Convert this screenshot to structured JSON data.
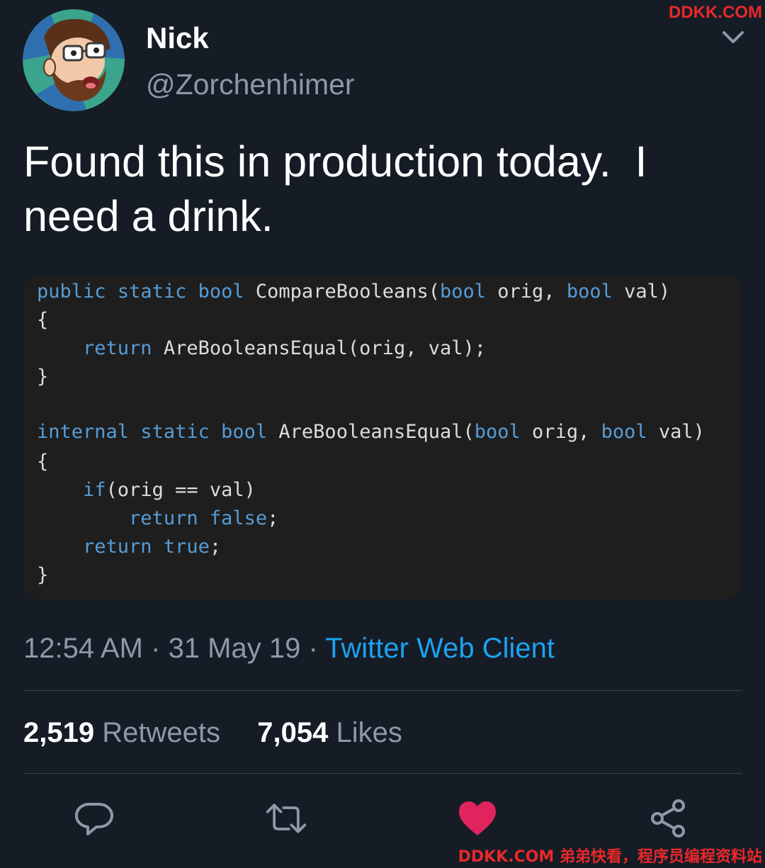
{
  "watermark": {
    "top": "DDKK.COM",
    "bottom": "DDKK.COM 弟弟快看，程序员编程资料站"
  },
  "author": {
    "name": "Nick",
    "handle": "@Zorchenhimer"
  },
  "icons": {
    "caret": "chevron-down-icon",
    "reply": "reply-icon",
    "retweet": "retweet-icon",
    "like": "heart-icon",
    "share": "share-icon"
  },
  "tweet": {
    "text": "Found this in production today.  I need a drink."
  },
  "code": {
    "lines": [
      {
        "indent": "",
        "parts": [
          [
            "kw",
            "public"
          ],
          [
            "t",
            " "
          ],
          [
            "kw",
            "static"
          ],
          [
            "t",
            " "
          ],
          [
            "kw",
            "bool"
          ],
          [
            "t",
            " CompareBooleans("
          ],
          [
            "kw",
            "bool"
          ],
          [
            "t",
            " orig, "
          ],
          [
            "kw",
            "bool"
          ],
          [
            "t",
            " val)"
          ]
        ]
      },
      {
        "indent": "",
        "parts": [
          [
            "t",
            "{"
          ]
        ]
      },
      {
        "indent": "    ",
        "parts": [
          [
            "kw",
            "return"
          ],
          [
            "t",
            " AreBooleansEqual(orig, val);"
          ]
        ]
      },
      {
        "indent": "",
        "parts": [
          [
            "t",
            "}"
          ]
        ]
      },
      {
        "indent": "",
        "parts": [
          [
            "kw",
            "internal"
          ],
          [
            "t",
            " "
          ],
          [
            "kw",
            "static"
          ],
          [
            "t",
            " "
          ],
          [
            "kw",
            "bool"
          ],
          [
            "t",
            " AreBooleansEqual("
          ],
          [
            "kw",
            "bool"
          ],
          [
            "t",
            " orig, "
          ],
          [
            "kw",
            "bool"
          ],
          [
            "t",
            " val)"
          ]
        ]
      },
      {
        "indent": "",
        "parts": [
          [
            "t",
            "{"
          ]
        ]
      },
      {
        "indent": "    ",
        "parts": [
          [
            "kw",
            "if"
          ],
          [
            "t",
            "(orig == val)"
          ]
        ]
      },
      {
        "indent": "        ",
        "parts": [
          [
            "kw",
            "return"
          ],
          [
            "t",
            " "
          ],
          [
            "kw",
            "false"
          ],
          [
            "t",
            ";"
          ]
        ]
      },
      {
        "indent": "    ",
        "parts": [
          [
            "kw",
            "return"
          ],
          [
            "t",
            " "
          ],
          [
            "kw",
            "true"
          ],
          [
            "t",
            ";"
          ]
        ]
      },
      {
        "indent": "",
        "parts": [
          [
            "t",
            "}"
          ]
        ]
      }
    ]
  },
  "meta": {
    "time": "12:54 AM",
    "sep1": " · ",
    "date": "31 May 19",
    "sep2": " · ",
    "client": "Twitter Web Client"
  },
  "stats": {
    "retweets_count": "2,519",
    "retweets_label": "Retweets",
    "likes_count": "7,054",
    "likes_label": "Likes"
  },
  "colors": {
    "background": "#151c26",
    "accent": "#1da1f2",
    "like": "#e0245e",
    "keyword": "#569cd6",
    "secondary_text": "#8d99a6"
  }
}
